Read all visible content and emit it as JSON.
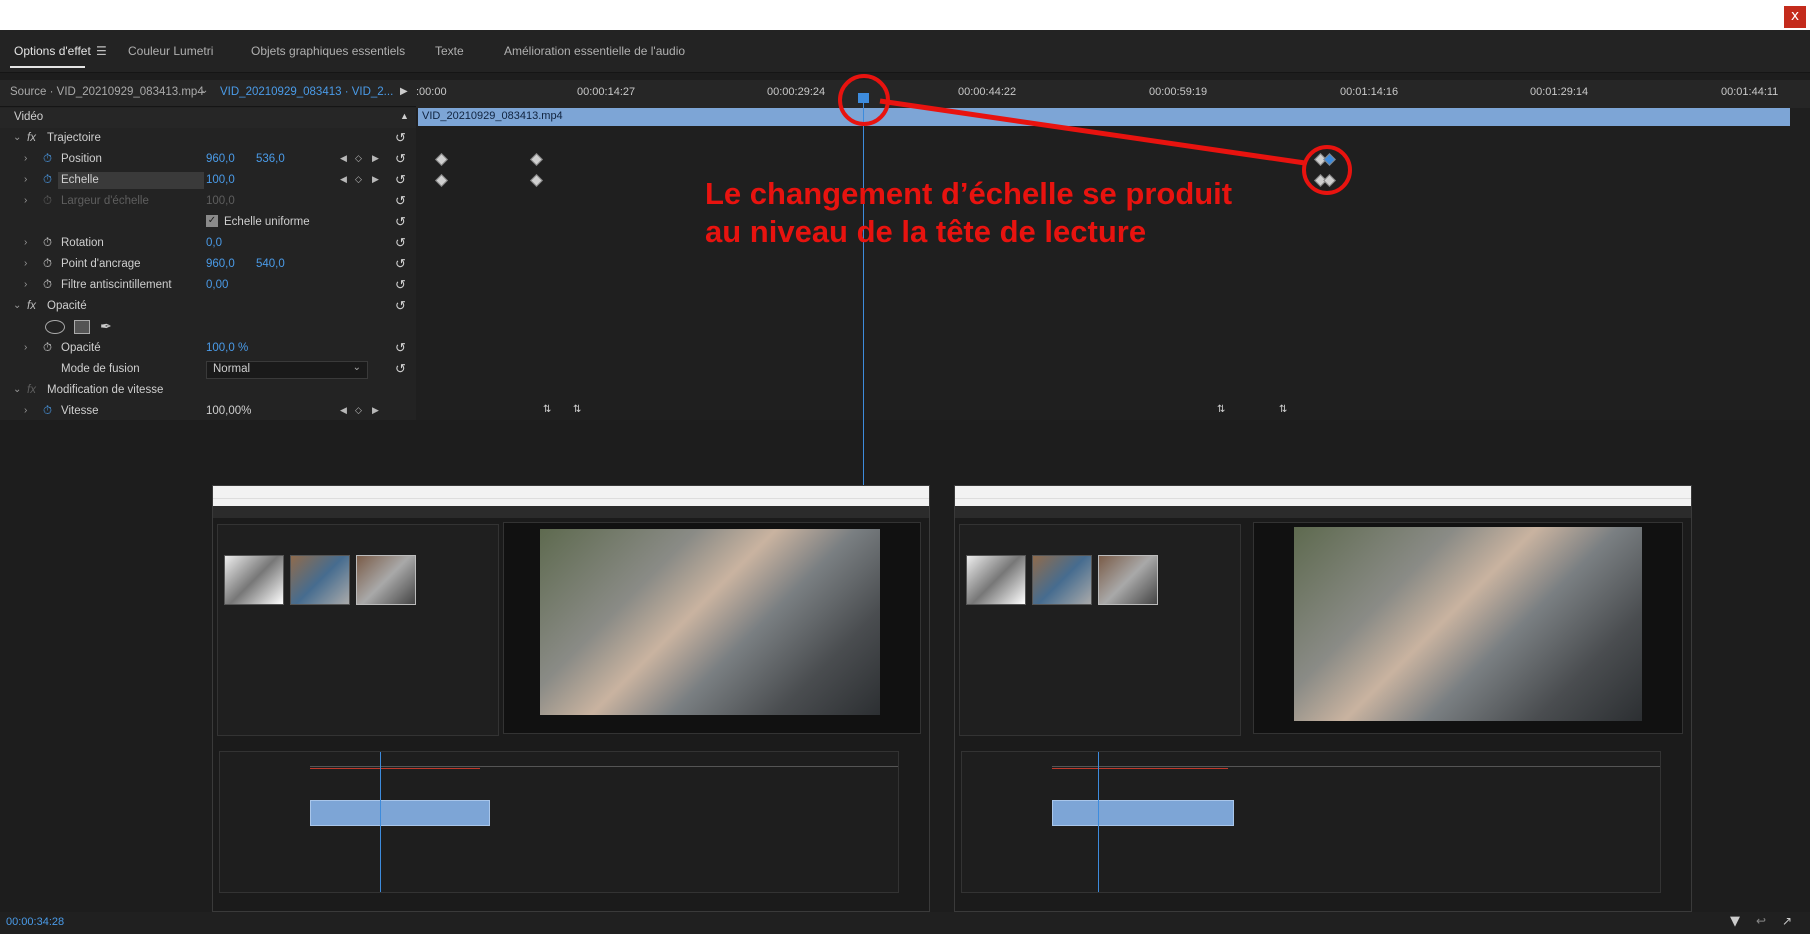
{
  "window": {
    "close_label": "x"
  },
  "tabs": [
    {
      "label": "Options d'effet"
    },
    {
      "label": "Couleur Lumetri"
    },
    {
      "label": "Objets graphiques essentiels"
    },
    {
      "label": "Texte"
    },
    {
      "label": "Amélioration essentielle de l'audio"
    }
  ],
  "source": {
    "source_label": "Source · VID_20210929_083413.mp4",
    "sequence_label": "VID_20210929_083413 · VID_2..."
  },
  "effects": {
    "section_video": "Vidéo",
    "trajectoire": "Trajectoire",
    "position": {
      "label": "Position",
      "x": "960,0",
      "y": "536,0"
    },
    "echelle": {
      "label": "Echelle",
      "value": "100,0"
    },
    "largeur": {
      "label": "Largeur d'échelle",
      "value": "100,0"
    },
    "uniforme": {
      "label": "Echelle uniforme"
    },
    "rotation": {
      "label": "Rotation",
      "value": "0,0"
    },
    "ancrage": {
      "label": "Point d'ancrage",
      "x": "960,0",
      "y": "540,0"
    },
    "filtre": {
      "label": "Filtre antiscintillement",
      "value": "0,00"
    },
    "opacite_section": "Opacité",
    "opacite": {
      "label": "Opacité",
      "value": "100,0 %"
    },
    "fusion": {
      "label": "Mode de fusion",
      "value": "Normal"
    },
    "vitesse_section": "Modification de vitesse",
    "vitesse": {
      "label": "Vitesse",
      "value": "100,00%"
    }
  },
  "ruler": {
    "ticks": [
      ":00:00",
      "00:00:14:27",
      "00:00:29:24",
      "00:00:44:22",
      "00:00:59:19",
      "00:01:14:16",
      "00:01:29:14",
      "00:01:44:11"
    ]
  },
  "clip": {
    "name": "VID_20210929_083413.mp4"
  },
  "annotation": {
    "line1": "Le changement d’échelle se produit",
    "line2": "au niveau de la tête de lecture"
  },
  "status": {
    "timecode": "00:00:34:28"
  },
  "colors": {
    "accent": "#3d8bdc",
    "annotation": "#e8130f",
    "clip": "#7da5d6"
  }
}
